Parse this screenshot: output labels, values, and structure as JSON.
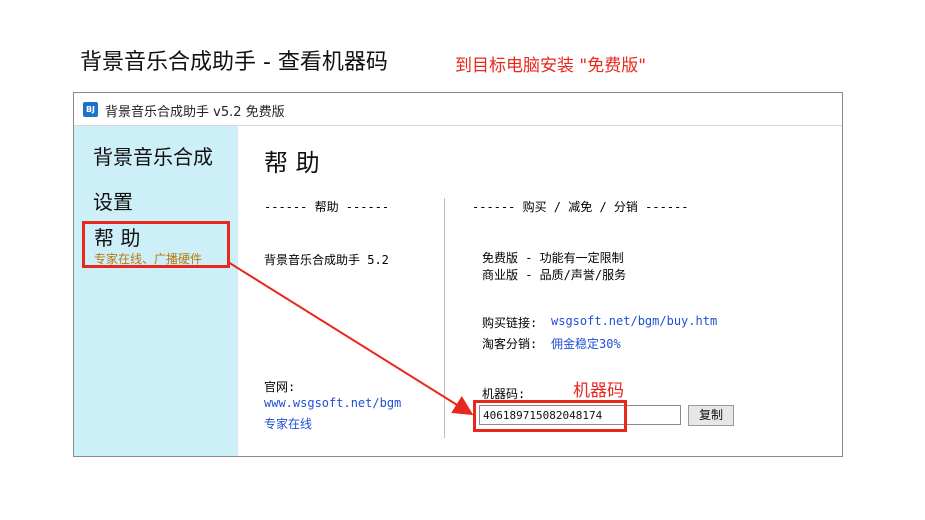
{
  "page": {
    "title": "背景音乐合成助手 - 查看机器码",
    "install_note": "到目标电脑安装 \"免费版\""
  },
  "window": {
    "icon_text": "BJ",
    "title": "背景音乐合成助手 v5.2 免费版"
  },
  "sidebar": {
    "items": [
      {
        "label": "背景音乐合成"
      },
      {
        "label": "设置"
      },
      {
        "label": "帮 助",
        "sub": "专家在线、广播硬件"
      }
    ]
  },
  "content": {
    "title": "帮 助",
    "help_header": "------ 帮助 ------",
    "app_version": "背景音乐合成助手 5.2",
    "site_label": "官网:",
    "site_url": "www.wsgsoft.net/bgm",
    "expert_link": "专家在线",
    "buy_header": "------ 购买 / 减免 / 分销 ------",
    "edition_free": "免费版 - 功能有一定限制",
    "edition_pro": "商业版 - 品质/声誉/服务",
    "buy_link_label": "购买链接:",
    "buy_link_url": "wsgsoft.net/bgm/buy.htm",
    "affiliate_label": "淘客分销:",
    "affiliate_value": "佣金稳定30%",
    "machine_code_label": "机器码:",
    "machine_code_value": "406189715082048174",
    "copy_button": "复制"
  },
  "annotation": {
    "machine_code_callout": "机器码",
    "color": "#e8281e"
  },
  "colors": {
    "sidebar_bg": "#cdeff8",
    "link": "#1f4fd6",
    "sub_text": "#b87a10"
  }
}
